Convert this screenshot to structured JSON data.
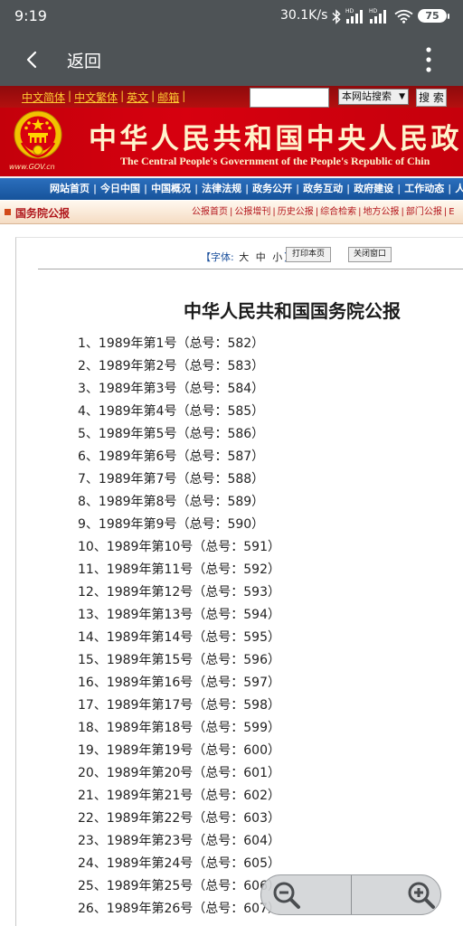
{
  "status_bar": {
    "time": "9:19",
    "net_speed": "30.1K/s",
    "hd_label": "HD",
    "battery": "75"
  },
  "app_bar": {
    "back_label": "返回"
  },
  "header": {
    "lang_links": [
      "中文简体",
      "中文繁体",
      "英文",
      "邮箱"
    ],
    "search_select": "本网站搜索",
    "search_button": "搜 索",
    "site_url": "www.GOV.cn",
    "title_cn": "中华人民共和国中央人民政",
    "title_en": "The Central People's Government of the People's Republic of Chin"
  },
  "main_nav": [
    "网站首页",
    "今日中国",
    "中国概况",
    "法律法规",
    "政务公开",
    "政务互动",
    "政府建设",
    "工作动态",
    "人"
  ],
  "section_bar": {
    "title": "国务院公报",
    "links": [
      "公报首页",
      "公报增刊",
      "历史公报",
      "综合检索",
      "地方公报",
      "部门公报",
      "E"
    ]
  },
  "toolbar": {
    "font_label": "【字体:",
    "sizes": [
      "大",
      "中",
      "小"
    ],
    "font_close": "】",
    "print": "打印本页",
    "close": "关闭窗口"
  },
  "page_title": "中华人民共和国国务院公报",
  "issues": [
    "1、1989年第1号（总号：582）",
    "2、1989年第2号（总号：583）",
    "3、1989年第3号（总号：584）",
    "4、1989年第4号（总号：585）",
    "5、1989年第5号（总号：586）",
    "6、1989年第6号（总号：587）",
    "7、1989年第7号（总号：588）",
    "8、1989年第8号（总号：589）",
    "9、1989年第9号（总号：590）",
    "10、1989年第10号（总号：591）",
    "11、1989年第11号（总号：592）",
    "12、1989年第12号（总号：593）",
    "13、1989年第13号（总号：594）",
    "14、1989年第14号（总号：595）",
    "15、1989年第15号（总号：596）",
    "16、1989年第16号（总号：597）",
    "17、1989年第17号（总号：598）",
    "18、1989年第18号（总号：599）",
    "19、1989年第19号（总号：600）",
    "20、1989年第20号（总号：601）",
    "21、1989年第21号（总号：602）",
    "22、1989年第22号（总号：603）",
    "23、1989年第23号（总号：604）",
    "24、1989年第24号（总号：605）",
    "25、1989年第25号（总号：606）",
    "26、1989年第26号（总号：607）"
  ],
  "icons": {
    "back": "chevron-left-icon",
    "menu": "more-vert-icon",
    "zoom_out": "zoom-out-icon",
    "zoom_in": "zoom-in-icon"
  },
  "colors": {
    "system_bar": "#4e5356",
    "banner_red": "#d7000f",
    "nav_blue": "#1d5ea8",
    "section_red": "#b3141a"
  }
}
